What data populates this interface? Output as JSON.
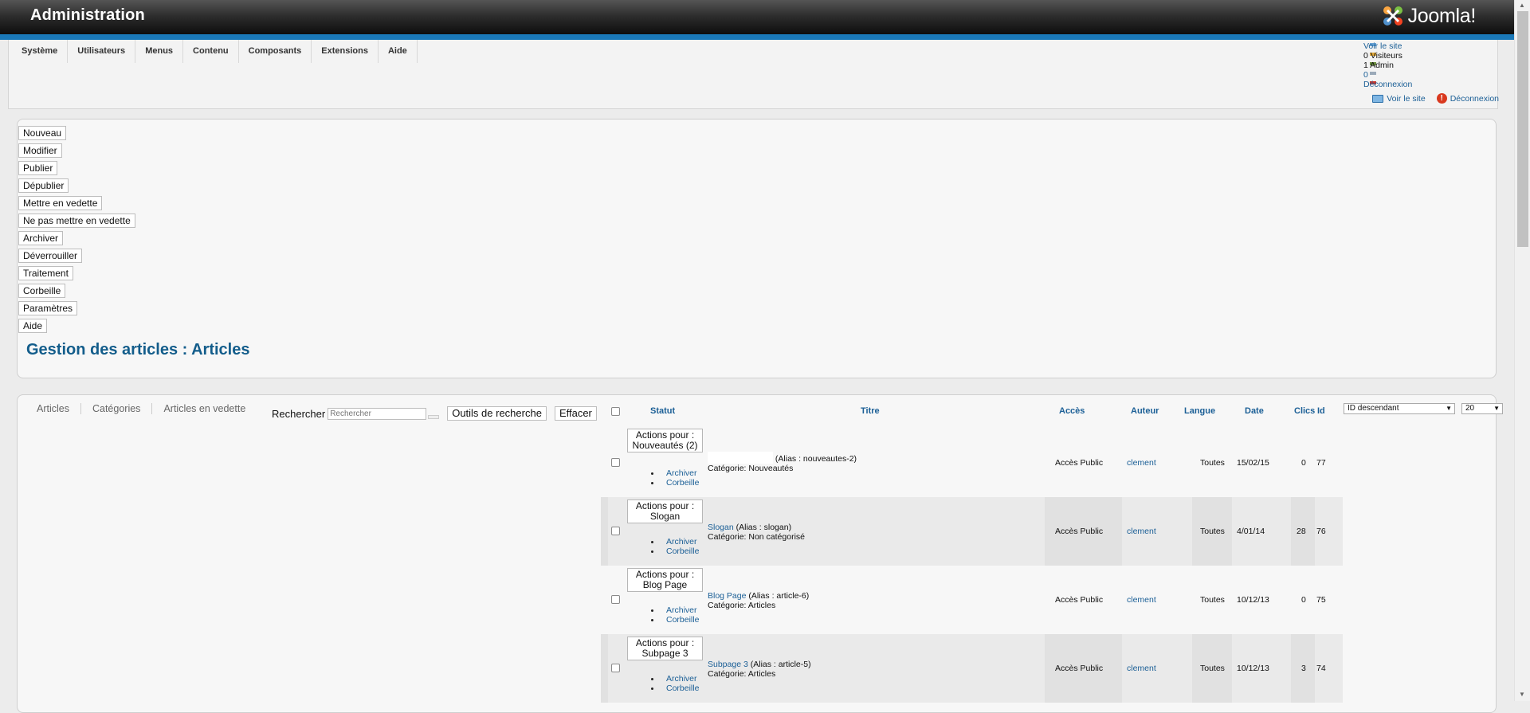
{
  "header": {
    "title": "Administration",
    "logo_text": "Joomla!"
  },
  "menu": {
    "items": [
      "Système",
      "Utilisateurs",
      "Menus",
      "Contenu",
      "Composants",
      "Extensions",
      "Aide"
    ]
  },
  "status": {
    "view_site_link": "Voir le site",
    "visitors": "0 Visiteurs",
    "admins": "1 Admin",
    "messages_count": "0",
    "logout_link": "Déconnexion",
    "view_site_label": "Voir le site",
    "logout_label": "Déconnexion",
    "view_site_icon": "monitor-icon",
    "logout_icon": "logout-icon"
  },
  "toolbar": {
    "new": "Nouveau",
    "edit": "Modifier",
    "publish": "Publier",
    "unpublish": "Dépublier",
    "feature": "Mettre en vedette",
    "unfeature": "Ne pas mettre en vedette",
    "archive": "Archiver",
    "checkin": "Déverrouiller",
    "batch": "Traitement",
    "trash": "Corbeille",
    "options": "Paramètres",
    "help": "Aide"
  },
  "page": {
    "heading": "Gestion des articles : Articles"
  },
  "submenu": {
    "articles": "Articles",
    "categories": "Catégories",
    "featured": "Articles en vedette"
  },
  "search": {
    "label": "Rechercher",
    "placeholder": "Rechercher",
    "tools_button": "Outils de recherche",
    "clear_button": "Effacer"
  },
  "table": {
    "headers": {
      "status": "Statut",
      "title": "Titre",
      "access": "Accès",
      "author": "Auteur",
      "language": "Langue",
      "date": "Date",
      "hits": "Clics",
      "id": "Id"
    },
    "ordering": "ID descendant",
    "limit": "20",
    "action_archive": "Archiver",
    "action_trash": "Corbeille",
    "rows": [
      {
        "actions": "Actions pour : Nouveautés (2)",
        "title": "",
        "alias": "(Alias : nouveautes-2)",
        "category": "Catégorie: Nouveautés",
        "access": "Accès Public",
        "author": "clement",
        "language": "Toutes",
        "date": "15/02/15",
        "hits": "0",
        "id": "77"
      },
      {
        "actions": "Actions pour : Slogan",
        "title": "Slogan",
        "alias": "(Alias : slogan)",
        "category": "Catégorie: Non catégorisé",
        "access": "Accès Public",
        "author": "clement",
        "language": "Toutes",
        "date": "4/01/14",
        "hits": "28",
        "id": "76"
      },
      {
        "actions": "Actions pour : Blog Page",
        "title": "Blog Page",
        "alias": "(Alias : article-6)",
        "category": "Catégorie: Articles",
        "access": "Accès Public",
        "author": "clement",
        "language": "Toutes",
        "date": "10/12/13",
        "hits": "0",
        "id": "75"
      },
      {
        "actions": "Actions pour : Subpage 3",
        "title": "Subpage 3",
        "alias": "(Alias : article-5)",
        "category": "Catégorie: Articles",
        "access": "Accès Public",
        "author": "clement",
        "language": "Toutes",
        "date": "10/12/13",
        "hits": "3",
        "id": "74"
      }
    ]
  }
}
